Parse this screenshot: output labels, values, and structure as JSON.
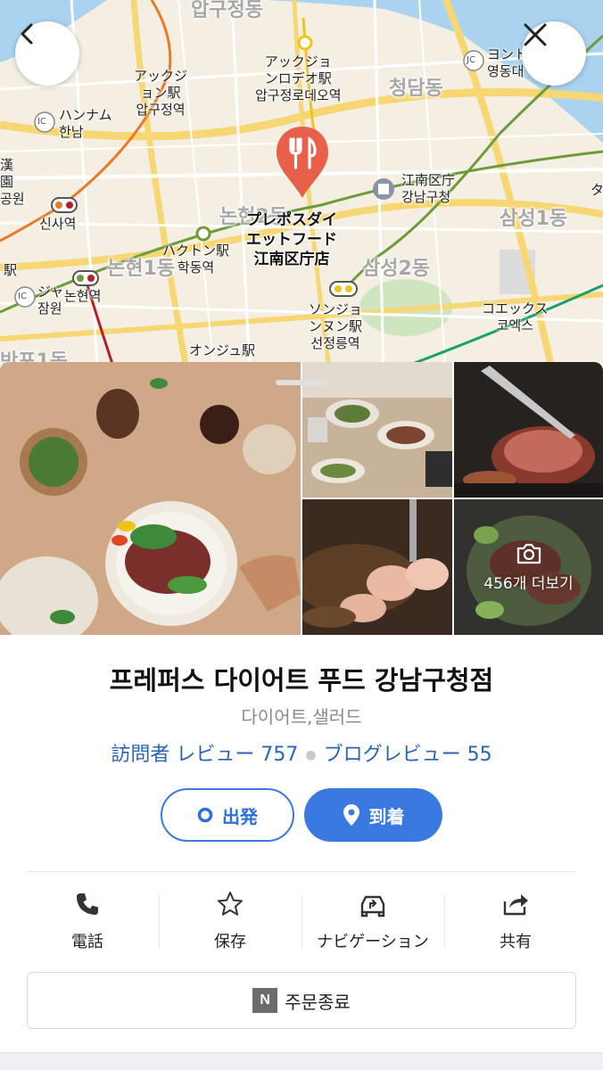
{
  "map": {
    "labels": {
      "apgujeong_dong": "압구정동",
      "apgujeong_station": "アックジ\nョン駅\n압구정역",
      "apgujeong_rodeo": "アックジョ\nンロデオ駅\n압구정로데오역",
      "cheongdam_dong": "청담동",
      "hannam": "ハンナム\n한남",
      "sinsa_station": "신사역",
      "hakdong_station": "ハクトン駅\n학동역",
      "nonhyeon2_dong": "논현2동",
      "nonhyeon1_dong": "논현1동",
      "nonhyeon_station": "논현역",
      "jamwon": "ジャ\n잠원",
      "gangnam_office": "江南区庁\n강남구청",
      "samseong1_dong": "삼성1동",
      "samseong2_dong": "삼성2동",
      "seonjeongneung": "ソンジョ\nンヌン駅\n선정릉역",
      "coex": "コエックス\n코엑스",
      "eonju_station": "オンジュ駅",
      "banpo1_dong": "반포1동",
      "yeongdong": "ヨント\n영동대",
      "place_pin_label": "プレポスダイ\nエットフード\n江南区庁店",
      "ic_label": "IC",
      "jc_label": "JC",
      "han_partial": "漢\n園\n공원",
      "station_partial": "駅",
      "ta_partial": "タ"
    }
  },
  "nav": {
    "back_icon": "chevron-left-icon",
    "close_icon": "close-icon"
  },
  "photos": {
    "more_label": "456개 더보기"
  },
  "place": {
    "title": "프레퍼스 다이어트 푸드 강남구청점",
    "category": "다이어트,샐러드",
    "visitor_reviews": "訪問者 レビュー 757",
    "blog_reviews": "ブログレビュー 55"
  },
  "route": {
    "depart_label": "出発",
    "arrive_label": "到着"
  },
  "actions": {
    "phone": "電話",
    "save": "保存",
    "navigation": "ナビゲーション",
    "share": "共有"
  },
  "order": {
    "logo": "N",
    "label": "주문종료"
  },
  "colors": {
    "accent": "#3a7ae0",
    "pin": "#e8604a",
    "review_link": "#2c63b5"
  }
}
